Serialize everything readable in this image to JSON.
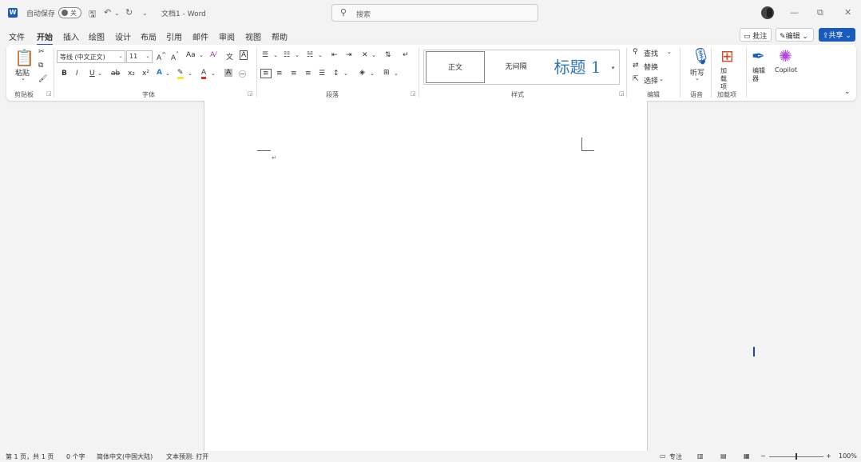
{
  "titlebar": {
    "app_icon": "W",
    "autosave_label": "自动保存",
    "autosave_state": "关",
    "doc_title": "文档1 - Word",
    "search_placeholder": "搜索"
  },
  "menu": {
    "tabs": [
      "文件",
      "开始",
      "插入",
      "绘图",
      "设计",
      "布局",
      "引用",
      "邮件",
      "审阅",
      "视图",
      "帮助"
    ],
    "active": "开始",
    "comment_btn": "批注",
    "edit_btn": "编辑",
    "share_btn": "共享"
  },
  "ribbon": {
    "groups": {
      "clipboard": "剪贴板",
      "font": "字体",
      "paragraph": "段落",
      "styles": "样式",
      "editing": "编辑",
      "voice": "语音",
      "addins": "加载项"
    },
    "paste_label": "粘贴",
    "font_name": "等线 (中文正文)",
    "font_size": "11",
    "change_case": "Aa",
    "styles": [
      "正文",
      "无间隔",
      "标题 1"
    ],
    "find_label": "查找",
    "replace_label": "替换",
    "select_label": "选择",
    "dictate_label": "听写",
    "addins_label": "加载项",
    "editor_label": "编辑器",
    "copilot_label": "Copilot"
  },
  "document": {
    "para_mark": "↵"
  },
  "statusbar": {
    "page": "第 1 页，共 1 页",
    "words": "0 个字",
    "language": "简体中文(中国大陆)",
    "prediction": "文本预测: 打开",
    "focus": "专注",
    "zoom": "100%"
  }
}
